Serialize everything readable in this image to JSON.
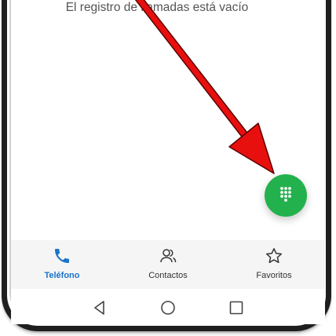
{
  "call_log": {
    "empty_message": "El registro de llamadas está vacío"
  },
  "fab": {
    "icon": "dialpad-icon",
    "color": "#23b14d"
  },
  "bottom_nav": {
    "items": [
      {
        "label": "Teléfono",
        "icon": "phone-icon",
        "active": true
      },
      {
        "label": "Contactos",
        "icon": "contacts-icon",
        "active": false
      },
      {
        "label": "Favoritos",
        "icon": "star-icon",
        "active": false
      }
    ],
    "active_color": "#1a73c8"
  },
  "system_nav": {
    "buttons": [
      "back-icon",
      "home-icon",
      "recents-icon"
    ]
  },
  "annotation": {
    "color": "#e8100f"
  }
}
